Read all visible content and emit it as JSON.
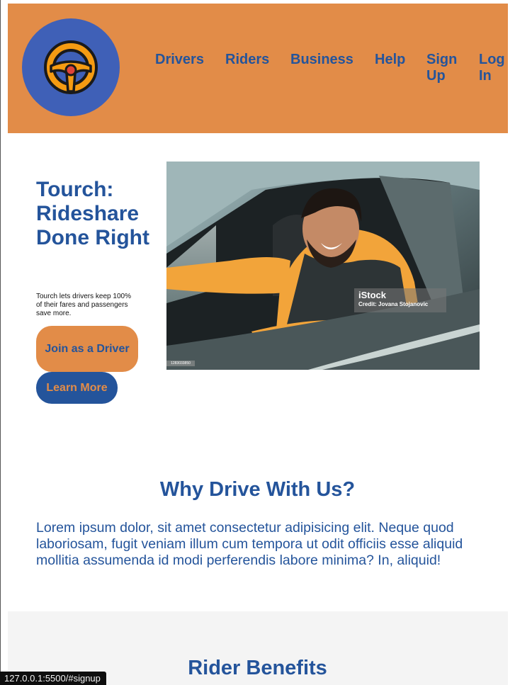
{
  "header": {
    "logo_icon": "steering-wheel-icon",
    "nav": [
      "Drivers",
      "Riders",
      "Business",
      "Help",
      "Sign Up",
      "Log In"
    ]
  },
  "hero": {
    "title": "Tourch: Rideshare Done Right",
    "text": "Tourch lets drivers keep 100% of their fares and passengers save more.",
    "join_button": "Join as a Driver",
    "learn_button": "Learn More",
    "photo_watermark": "iStock",
    "photo_credit": "Credit: Jovana Stojanovic",
    "photo_id": "1283033850"
  },
  "why": {
    "title": "Why Drive With Us?",
    "text": "Lorem ipsum dolor, sit amet consectetur adipisicing elit. Neque quod laboriosam, fugit veniam illum cum tempora ut odit officiis esse aliquid mollitia assumenda id modi perferendis labore minima? In, aliquid!"
  },
  "rider": {
    "title": "Rider Benefits"
  },
  "status_bar": {
    "url": "127.0.0.1:5500/#signup"
  },
  "colors": {
    "brand_orange": "#e28c48",
    "brand_blue": "#24549b",
    "logo_blue": "#3f60b7"
  }
}
